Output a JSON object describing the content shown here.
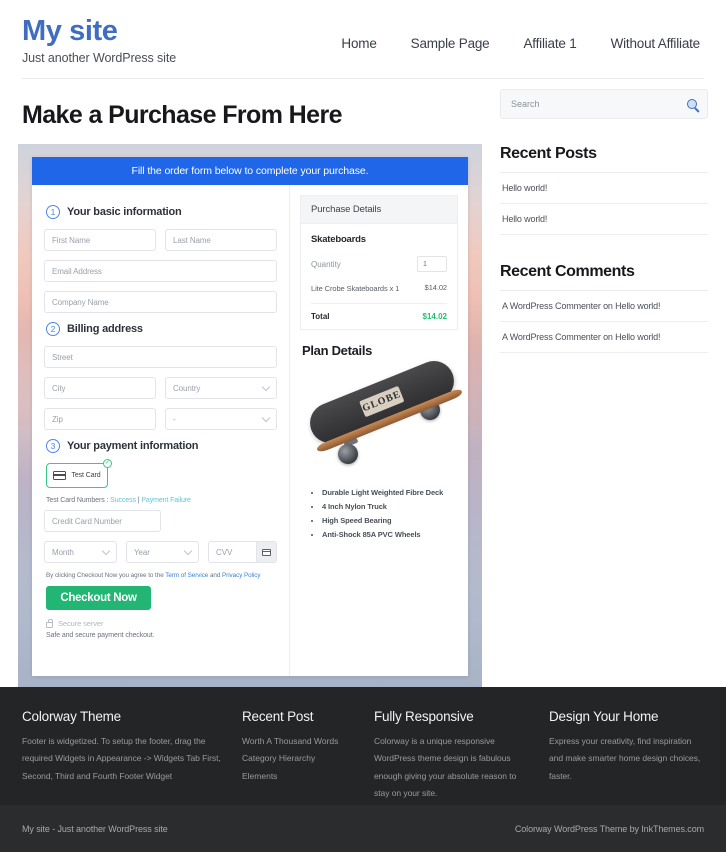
{
  "header": {
    "site_title": "My site",
    "tagline": "Just another WordPress site",
    "nav": [
      {
        "label": "Home"
      },
      {
        "label": "Sample Page"
      },
      {
        "label": "Affiliate 1"
      },
      {
        "label": "Without Affiliate"
      }
    ]
  },
  "main": {
    "page_title": "Make a Purchase From Here",
    "banner": "Fill the order form below to complete your purchase.",
    "steps": [
      {
        "num": "1",
        "label": "Your basic information"
      },
      {
        "num": "2",
        "label": "Billing address"
      },
      {
        "num": "3",
        "label": "Your payment information"
      }
    ],
    "fields": {
      "first_name": "First Name",
      "last_name": "Last Name",
      "email": "Email Address",
      "company": "Company Name",
      "street": "Street",
      "city": "City",
      "country": "Country",
      "zip": "Zip",
      "state": "-",
      "credit_card": "Credit Card Number",
      "month": "Month",
      "year": "Year",
      "cvv": "CVV"
    },
    "payment": {
      "card_option_label": "Test  Card",
      "check_glyph": "✓",
      "test_card_prefix": "Test Card Numbers : ",
      "test_card_success": "Success",
      "test_card_separator": " | ",
      "test_card_failure": "Payment Failure",
      "terms_prefix": "By clicking Checkout Now you agree to the ",
      "terms_link": "Term of Service",
      "terms_middle": " and ",
      "privacy_link": "Privacy Policy",
      "checkout_button": "Checkout Now",
      "secure_server": "Secure server",
      "safe_note": "Safe and secure payment checkout."
    },
    "summary": {
      "heading": "Purchase Details",
      "product": "Skateboards",
      "quantity_label": "Quantity",
      "quantity_value": "1",
      "line_item_name": "Lite Crobe Skateboards x 1",
      "line_item_price": "$14.02",
      "total_label": "Total",
      "total_value": "$14.02"
    },
    "plan": {
      "title": "Plan Details",
      "board_logo": "GLOBE",
      "features": [
        "Durable Light Weighted Fibre Deck",
        "4 Inch Nylon Truck",
        "High Speed Bearing",
        "Anti-Shock 85A PVC Wheels"
      ]
    }
  },
  "sidebar": {
    "search_placeholder": "Search",
    "recent_posts_title": "Recent Posts",
    "recent_posts": [
      {
        "label": "Hello world!"
      },
      {
        "label": "Hello world!"
      }
    ],
    "recent_comments_title": "Recent Comments",
    "recent_comments": [
      {
        "label": "A WordPress Commenter on Hello world!"
      },
      {
        "label": "A WordPress Commenter on Hello world!"
      }
    ]
  },
  "footer": {
    "columns": [
      {
        "title": "Colorway Theme",
        "text": "Footer is widgetized. To setup the footer, drag the required Widgets in Appearance -> Widgets Tab First, Second, Third and Fourth Footer Widget"
      },
      {
        "title": "Recent Post",
        "items": [
          {
            "label": "Worth A Thousand Words"
          },
          {
            "label": "Category Hierarchy"
          },
          {
            "label": "Elements"
          }
        ]
      },
      {
        "title": "Fully Responsive",
        "text": "Colorway is a unique responsive WordPress theme design is fabulous enough giving your absolute reason to stay on your site."
      },
      {
        "title": "Design Your Home",
        "text": "Express your creativity, find inspiration and make smarter home design choices, faster."
      }
    ],
    "copyright_left": "My site - Just another WordPress site",
    "copyright_right": "Colorway WordPress Theme by InkThemes.com"
  },
  "colors": {
    "brand_blue": "#3f6ec1",
    "banner_blue": "#1f66e8",
    "accent_green": "#22b573",
    "total_green": "#1fc271",
    "link_teal": "#5bc6d8",
    "footer_dark": "#242527"
  }
}
